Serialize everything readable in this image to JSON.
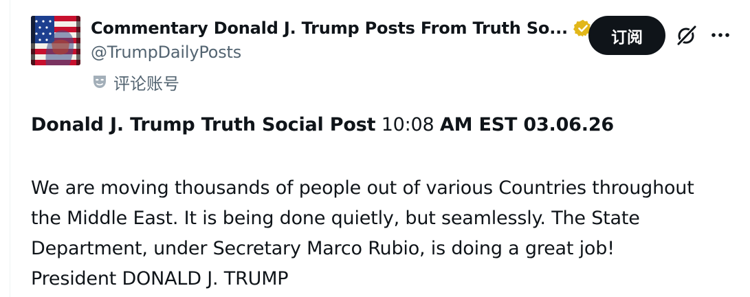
{
  "profile": {
    "display_name": "Commentary Donald J. Trump Posts From Truth So...",
    "handle": "@TrumpDailyPosts",
    "account_label": "评论账号",
    "avatar_icon": "flag-portrait-avatar",
    "verified_icon": "gold-verified-badge-icon",
    "label_icon": "theater-mask-icon"
  },
  "actions": {
    "subscribe_label": "订阅",
    "grok_icon": "grok-icon",
    "more_icon": "more-options-icon"
  },
  "post": {
    "header_bold_1": "Donald J. Trump Truth Social Post",
    "header_time": " 10:08 ",
    "header_bold_2": "AM EST 03.06.26",
    "lines": [
      "We are moving thousands of people out of various Countries throughout",
      "the Middle East. It is being done quietly, but seamlessly. The State",
      "Department, under Secretary Marco Rubio, is doing a great job!",
      "President DONALD J. TRUMP"
    ]
  },
  "colors": {
    "text_primary": "#0f1419",
    "text_secondary": "#536471",
    "button_bg": "#0f1419",
    "verified_gold": "#e2b719"
  }
}
